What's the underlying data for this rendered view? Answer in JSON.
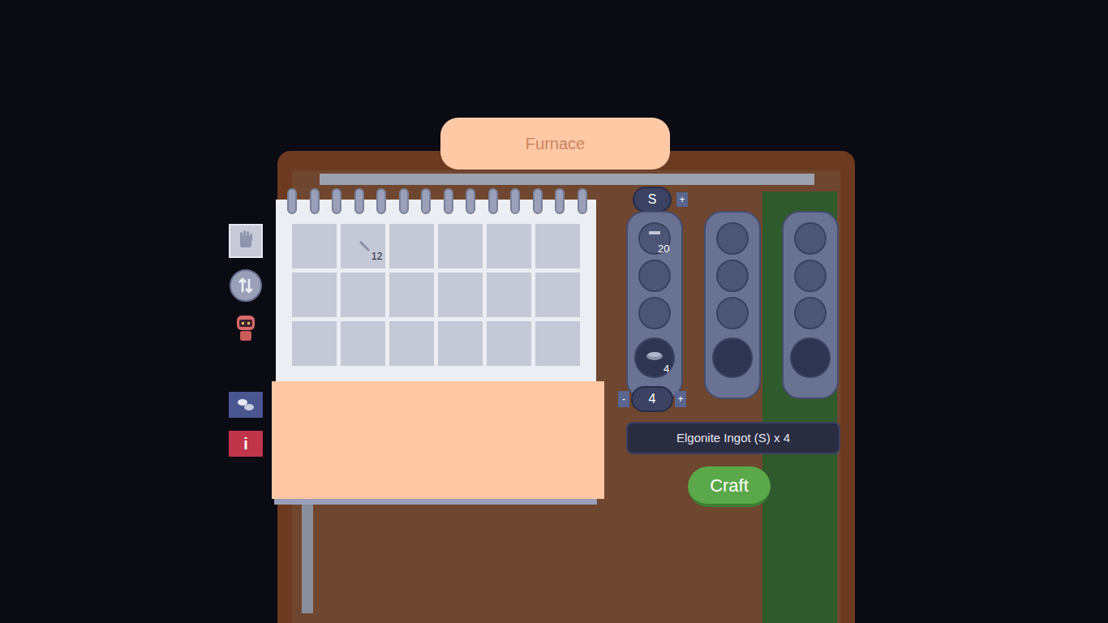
{
  "window": {
    "title": "Furnace"
  },
  "sidebar": {
    "tools": [
      {
        "kind": "hand",
        "selected": true
      },
      {
        "kind": "swap",
        "selected": false
      },
      {
        "kind": "robot",
        "selected": false
      }
    ],
    "info_button": {
      "label": "i"
    }
  },
  "inventory": {
    "slots": [
      {
        "filled": false,
        "count": ""
      },
      {
        "filled": true,
        "count": "12"
      },
      {
        "filled": false,
        "count": ""
      },
      {
        "filled": false,
        "count": ""
      },
      {
        "filled": false,
        "count": ""
      },
      {
        "filled": false,
        "count": ""
      },
      {
        "filled": false,
        "count": ""
      },
      {
        "filled": false,
        "count": ""
      },
      {
        "filled": false,
        "count": ""
      },
      {
        "filled": false,
        "count": ""
      },
      {
        "filled": false,
        "count": ""
      },
      {
        "filled": false,
        "count": ""
      },
      {
        "filled": false,
        "count": ""
      },
      {
        "filled": false,
        "count": ""
      },
      {
        "filled": false,
        "count": ""
      },
      {
        "filled": false,
        "count": ""
      },
      {
        "filled": false,
        "count": ""
      },
      {
        "filled": false,
        "count": ""
      }
    ]
  },
  "recipe": {
    "size": {
      "label": "S",
      "plus": "+"
    },
    "columns": [
      {
        "slots": [
          {
            "filled": true,
            "count": "20"
          },
          {
            "filled": false,
            "count": ""
          },
          {
            "filled": false,
            "count": ""
          },
          {
            "filled": true,
            "count": "4"
          }
        ]
      },
      {
        "slots": [
          {
            "filled": false,
            "count": ""
          },
          {
            "filled": false,
            "count": ""
          },
          {
            "filled": false,
            "count": ""
          },
          {
            "filled": false,
            "count": ""
          }
        ]
      },
      {
        "slots": [
          {
            "filled": false,
            "count": ""
          },
          {
            "filled": false,
            "count": ""
          },
          {
            "filled": false,
            "count": ""
          },
          {
            "filled": false,
            "count": ""
          }
        ]
      }
    ],
    "quantity": {
      "minus": "-",
      "value": "4",
      "plus": "+"
    },
    "result": "Elgonite Ingot (S) x 4"
  },
  "craft_button": {
    "label": "Craft"
  }
}
